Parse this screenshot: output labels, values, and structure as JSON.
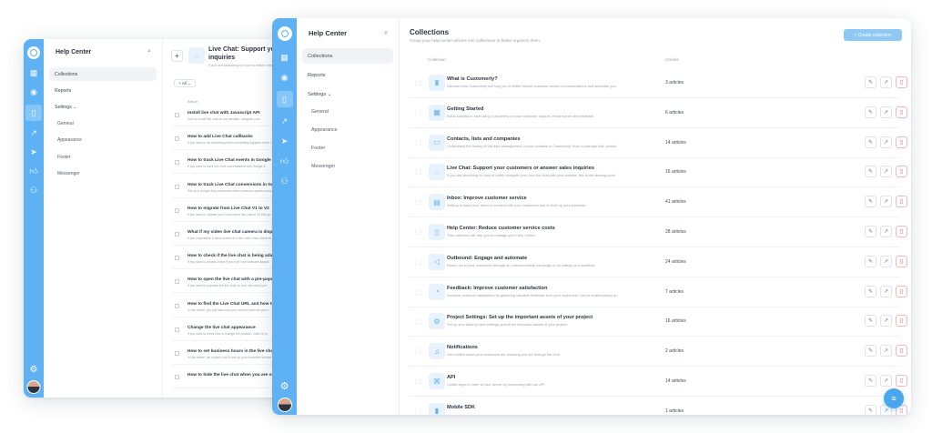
{
  "back_window": {
    "sidebar": {
      "title": "Help Center",
      "nav": [
        "Collections",
        "Reports",
        "Settings"
      ],
      "settings_chevron": "⌄",
      "sub": [
        "General",
        "Appearance",
        "Footer",
        "Messenger"
      ]
    },
    "collection": {
      "title_line1": "Live Chat: Support your cust",
      "title_line2": "inquiries",
      "subtitle": "If you are searching for how to better integ",
      "add_symbol": "+",
      "filter_label": "All",
      "column_article": "Article"
    },
    "articles": [
      {
        "title": "Install live chat with Javascript API",
        "desc": "How to install live chat on any website, integrate your"
      },
      {
        "title": "How to add Live Chat callbacks",
        "desc": "If you want to do something when something happens in the Cu"
      },
      {
        "title": "How to track Live Chat events in Google Analytics",
        "desc": "If you want to track live chat conversations with Google A"
      },
      {
        "title": "How to track Live Chat conversions in Google Ads",
        "desc": "Set up a Google Ads conversion when someone opens a new"
      },
      {
        "title": "How to migrate from Live Chat V1 to V2",
        "desc": "If you want to migrate your Customerly live chat to V2 this gu"
      },
      {
        "title": "What if my video live chat camera is displaying a bl",
        "desc": "If you experience a black screen in a live video chat, check th"
      },
      {
        "title": "How to check if the live chat is being adapted to yo",
        "desc": "If you want to double-check if your live chat software adapts"
      },
      {
        "title": "How to open the live chat with a pre-populated me",
        "desc": "If you want to populate the live chat on your site with a pre-"
      },
      {
        "title": "How to find the Live Chat URL and how to use it",
        "desc": "In this article, you will learn how you can find and use your L"
      },
      {
        "title": "Change the live chat appearance",
        "desc": "If you want to know how to change the position, color of yo"
      },
      {
        "title": "How to set business hours in the live chat",
        "desc": "In this article, we explain how to set up your customer service"
      },
      {
        "title": "How to hide the live chat when you are not in the o",
        "desc": ""
      }
    ]
  },
  "front_window": {
    "sidebar": {
      "title": "Help Center",
      "nav": [
        "Collections",
        "Reports",
        "Settings"
      ],
      "settings_chevron": "⌄",
      "sub": [
        "General",
        "Appearance",
        "Footer",
        "Messenger"
      ]
    },
    "header": {
      "title": "Collections",
      "subtitle": "Group your help center articles into collections to better organize them",
      "create_button": "+ Create collection"
    },
    "table": {
      "col_collection": "Collection",
      "col_articles": "Articles",
      "rows": [
        {
          "title": "What is Customerly?",
          "desc": "Discover how Customerly will help you to better handle customer-centric communications and automate you",
          "count": "3 articles",
          "icon": "rocket-icon"
        },
        {
          "title": "Getting Started",
          "desc": "Basic tutorials to start using Customerly for your customer support, email funnel and feedback",
          "count": "6 articles",
          "icon": "grid-icon"
        },
        {
          "title": "Contacts, lists and companies",
          "desc": "Understand the history of the data management of your contacts in Customerly. How to manage lists, contac",
          "count": "14 articles",
          "icon": "folder-icon"
        },
        {
          "title": "Live Chat: Support your customers or answer sales inquiries",
          "desc": "If you are searching for how to better integrate your new live chat with your website, this is the starting point",
          "count": "16 articles",
          "icon": "chat-icon"
        },
        {
          "title": "Inbox: Improve customer service",
          "desc": "Getting to know your inbox to connect with your customers and to level up your business",
          "count": "41 articles",
          "icon": "inbox-icon"
        },
        {
          "title": "Help Center: Reduce customer service costs",
          "desc": "This collection will help you to manage your Help Center",
          "count": "28 articles",
          "icon": "book-icon"
        },
        {
          "title": "Outbound: Engage and automate",
          "desc": "Reach out to your customers through an outbound email campaign or by setting up a workflow.",
          "count": "24 articles",
          "icon": "megaphone-icon"
        },
        {
          "title": "Feedback: Improve customer satisfaction",
          "desc": "Increase customer satisfaction by gathering valuable feedback from your customers. Use in email surveys an",
          "count": "7 articles",
          "icon": "feedback-icon"
        },
        {
          "title": "Project Settings: Set up the important assets of your project",
          "desc": "Set up your basic project settings and all the important assets of your project",
          "count": "16 articles",
          "icon": "settings-icon"
        },
        {
          "title": "Notifications",
          "desc": "Get notified when your customers are reaching you out through the chat",
          "count": "2 articles",
          "icon": "bell-icon"
        },
        {
          "title": "API",
          "desc": "Create Apps in order to your server by connecting with our API",
          "count": "14 articles",
          "icon": "code-icon"
        },
        {
          "title": "Mobile SDK",
          "desc": "",
          "count": "1 articles",
          "icon": "mobile-icon"
        }
      ]
    }
  },
  "colors": {
    "accent": "#5eb2f4",
    "danger": "#e25555"
  }
}
